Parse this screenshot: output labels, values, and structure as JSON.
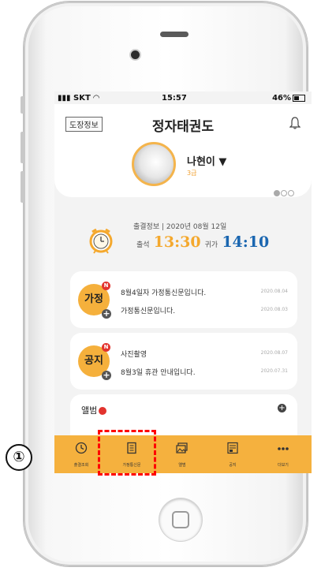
{
  "status_bar": {
    "carrier": "SKT",
    "time": "15:57",
    "battery": "46%"
  },
  "header": {
    "dojang_button": "도장정보",
    "title": "정자태권도",
    "bell_icon": "bell-icon"
  },
  "profile": {
    "name": "나현이 ▼",
    "grade": "3급",
    "carousel_active_index": 0,
    "carousel_count": 3
  },
  "attendance": {
    "label": "출결정보 | 2020년 08월 12일",
    "in_label": "출석",
    "in_time": "13:30",
    "out_label": "귀가",
    "out_time": "14:10",
    "icon": "alarm-clock-icon"
  },
  "family_notice": {
    "badge": "가정",
    "new_badge": "N",
    "items": [
      {
        "text": "8월4일자 가정통신문입니다.",
        "date": "2020.08.04"
      },
      {
        "text": "가정통신문입니다.",
        "date": "2020.08.03"
      }
    ]
  },
  "notice": {
    "badge": "공지",
    "new_badge": "N",
    "items": [
      {
        "text": "사진촬영",
        "date": "2020.08.07"
      },
      {
        "text": "8월3일 휴관 안내입니다.",
        "date": "2020.07.31"
      }
    ]
  },
  "album": {
    "label": "앨범"
  },
  "nav": {
    "items": [
      {
        "label": "출결조회",
        "icon": "clock-icon"
      },
      {
        "label": "가정통신문",
        "icon": "document-icon"
      },
      {
        "label": "앨범",
        "icon": "photo-icon"
      },
      {
        "label": "공지",
        "icon": "notice-icon"
      },
      {
        "label": "더보기",
        "icon": "more-icon"
      }
    ]
  },
  "annotation": {
    "step_marker": "①"
  },
  "colors": {
    "accent": "#f5b13e",
    "time_in": "#f4a82d",
    "time_out": "#1a66b0",
    "new_badge": "#e2332e",
    "highlight_box": "#ff0000"
  }
}
